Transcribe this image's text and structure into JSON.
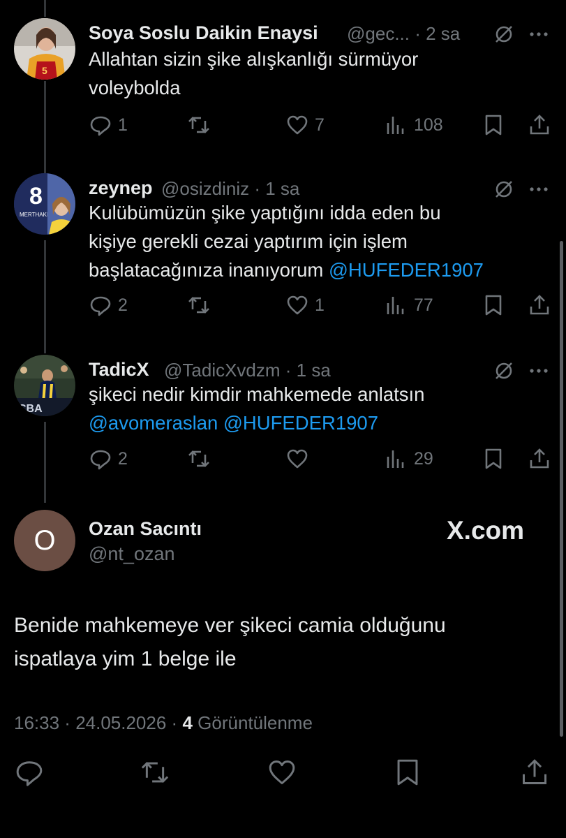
{
  "tweets": [
    {
      "name": "Soya Soslu Daikin Enaysi",
      "handle": "@gec...",
      "time": "· 2 sa",
      "text_lines": [
        "Allahtan sizin şike alışkanlığı sürmüyor",
        "voleybolda"
      ],
      "replies": "1",
      "retweets": "",
      "likes": "7",
      "views": "108"
    },
    {
      "name": "zeynep",
      "handle": "@osizdiniz",
      "time": "· 1 sa",
      "text_lines": [
        "Kulübümüzün şike yaptığını idda eden bu",
        "kişiye gerekli cezai yaptırım için işlem",
        "başlatacağınıza inanıyorum"
      ],
      "mention_line3": "@HUFEDER1907",
      "replies": "2",
      "retweets": "",
      "likes": "1",
      "views": "77"
    },
    {
      "name": "TadicX",
      "handle": "@TadicXvdzm",
      "time": "· 1 sa",
      "text_lines": [
        "şikeci nedir kimdir mahkemede anlatsın"
      ],
      "mentions": [
        "@avomeraslan",
        "@HUFEDER1907"
      ],
      "replies": "2",
      "retweets": "",
      "likes": "",
      "views": "29"
    }
  ],
  "main_post": {
    "avatar_letter": "O",
    "name": "Ozan Sacıntı",
    "handle": "@nt_ozan",
    "watermark": "X.com",
    "text_lines": [
      "Benide mahkemeye ver şikeci camia olduğunu",
      "ispatlaya yim 1 belge ile"
    ],
    "time": "16:33",
    "date": "24.05.2026",
    "views_count": "4",
    "views_label": "Görüntülenme"
  },
  "icons": {
    "reply": "reply-icon",
    "retweet": "retweet-icon",
    "like": "heart-icon",
    "views": "views-icon",
    "bookmark": "bookmark-icon",
    "share": "share-icon",
    "grok": "grok-icon",
    "more": "more-icon"
  },
  "colors": {
    "background": "#000000",
    "text": "#e7e9ea",
    "muted": "#71767b",
    "mention": "#1d9bf0",
    "avatar_main": "#6b4e44"
  }
}
